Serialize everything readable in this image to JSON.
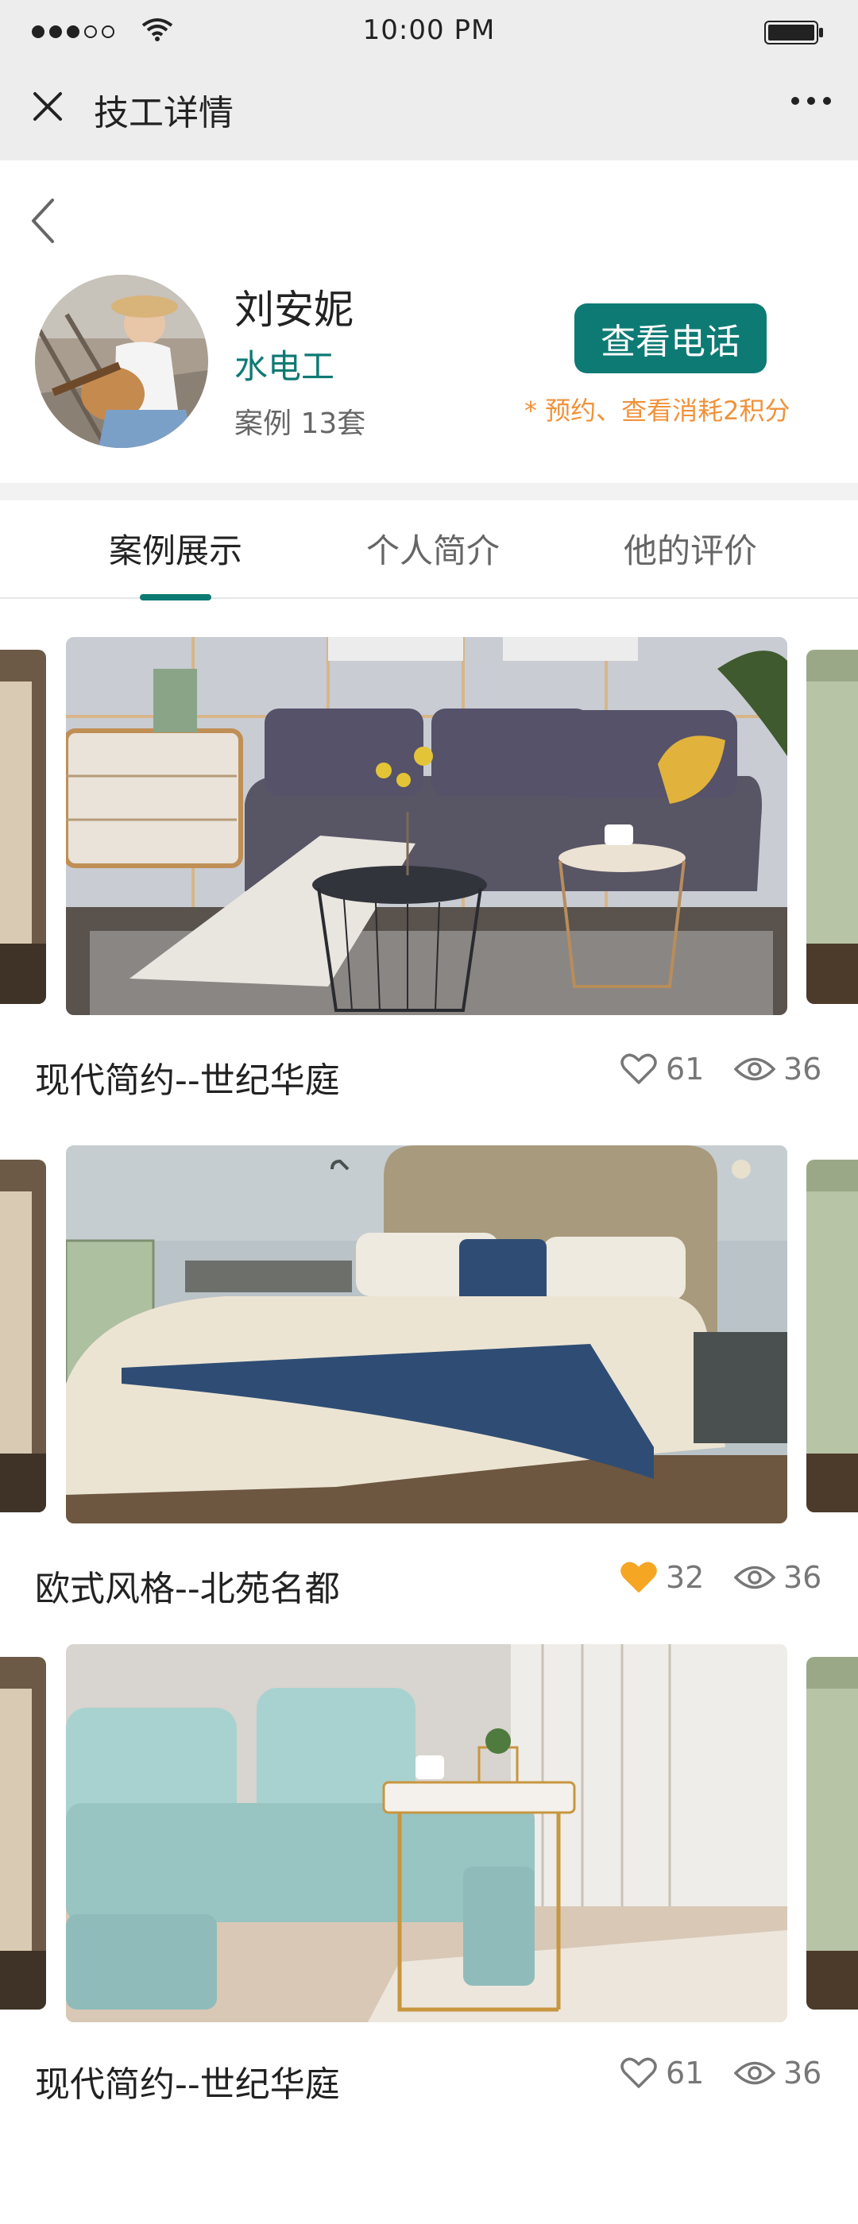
{
  "status_bar": {
    "time": "10:00 PM"
  },
  "nav": {
    "title": "技工详情"
  },
  "profile": {
    "name": "刘安妮",
    "role": "水电工",
    "cases_label": "案例",
    "cases_count": "13套",
    "phone_button": "查看电话",
    "phone_note": "* 预约、查看消耗2积分"
  },
  "tabs": [
    "案例展示",
    "个人简介",
    "他的评价"
  ],
  "cards": [
    {
      "title": "现代简约--世纪华庭",
      "likes": "61",
      "views": "36",
      "liked": false
    },
    {
      "title": "欧式风格--北苑名都",
      "likes": "32",
      "views": "36",
      "liked": true
    },
    {
      "title": "现代简约--世纪华庭",
      "likes": "61",
      "views": "36",
      "liked": false
    }
  ],
  "colors": {
    "accent": "#0e7a74",
    "note": "#f0923a",
    "liked": "#f5a623"
  }
}
